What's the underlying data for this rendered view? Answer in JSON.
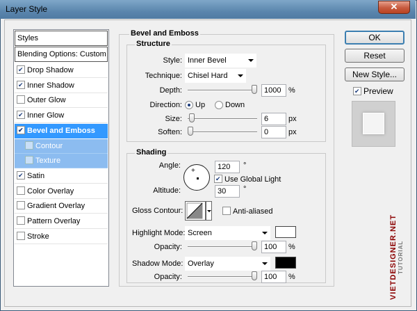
{
  "window": {
    "title": "Layer Style",
    "close": "✕"
  },
  "styles_list": {
    "header": "Styles",
    "blending": "Blending Options: Custom",
    "items": [
      {
        "label": "Drop Shadow",
        "checked": true
      },
      {
        "label": "Inner Shadow",
        "checked": true
      },
      {
        "label": "Outer Glow",
        "checked": false
      },
      {
        "label": "Inner Glow",
        "checked": true
      },
      {
        "label": "Bevel and Emboss",
        "checked": true,
        "selected": true
      },
      {
        "label": "Contour",
        "checked": false,
        "sub": true
      },
      {
        "label": "Texture",
        "checked": false,
        "sub": true
      },
      {
        "label": "Satin",
        "checked": true
      },
      {
        "label": "Color Overlay",
        "checked": false
      },
      {
        "label": "Gradient Overlay",
        "checked": false
      },
      {
        "label": "Pattern Overlay",
        "checked": false
      },
      {
        "label": "Stroke",
        "checked": false
      }
    ]
  },
  "bevel": {
    "title": "Bevel and Emboss",
    "structure": {
      "title": "Structure",
      "style_label": "Style:",
      "style_value": "Inner Bevel",
      "technique_label": "Technique:",
      "technique_value": "Chisel Hard",
      "depth_label": "Depth:",
      "depth_value": "1000",
      "depth_unit": "%",
      "depth_level": 1.0,
      "direction_label": "Direction:",
      "direction_up": "Up",
      "direction_down": "Down",
      "direction_selected": "Up",
      "size_label": "Size:",
      "size_value": "6",
      "size_unit": "px",
      "size_level": 0.02,
      "soften_label": "Soften:",
      "soften_value": "0",
      "soften_unit": "px",
      "soften_level": 0.0
    },
    "shading": {
      "title": "Shading",
      "angle_label": "Angle:",
      "angle_value": "120",
      "angle_unit": "°",
      "global_light_label": "Use Global Light",
      "global_light_checked": true,
      "altitude_label": "Altitude:",
      "altitude_value": "30",
      "altitude_unit": "°",
      "gloss_contour_label": "Gloss Contour:",
      "anti_aliased_label": "Anti-aliased",
      "anti_aliased_checked": false,
      "highlight_mode_label": "Highlight Mode:",
      "highlight_mode_value": "Screen",
      "highlight_color": "#ffffff",
      "highlight_opacity_label": "Opacity:",
      "highlight_opacity_value": "100",
      "highlight_opacity_unit": "%",
      "highlight_opacity_level": 1.0,
      "shadow_mode_label": "Shadow Mode:",
      "shadow_mode_value": "Overlay",
      "shadow_color": "#000000",
      "shadow_opacity_label": "Opacity:",
      "shadow_opacity_value": "100",
      "shadow_opacity_unit": "%",
      "shadow_opacity_level": 1.0
    }
  },
  "buttons": {
    "ok": "OK",
    "reset": "Reset",
    "new_style": "New Style...",
    "preview": "Preview",
    "preview_checked": true
  },
  "watermark": {
    "line1": "VIETDESIGNER.NET",
    "line2": "TUTORIAL"
  },
  "colors": {
    "selection": "#3399ff",
    "subselection": "#8cbcf0",
    "title_bar": "#5b86ad"
  }
}
